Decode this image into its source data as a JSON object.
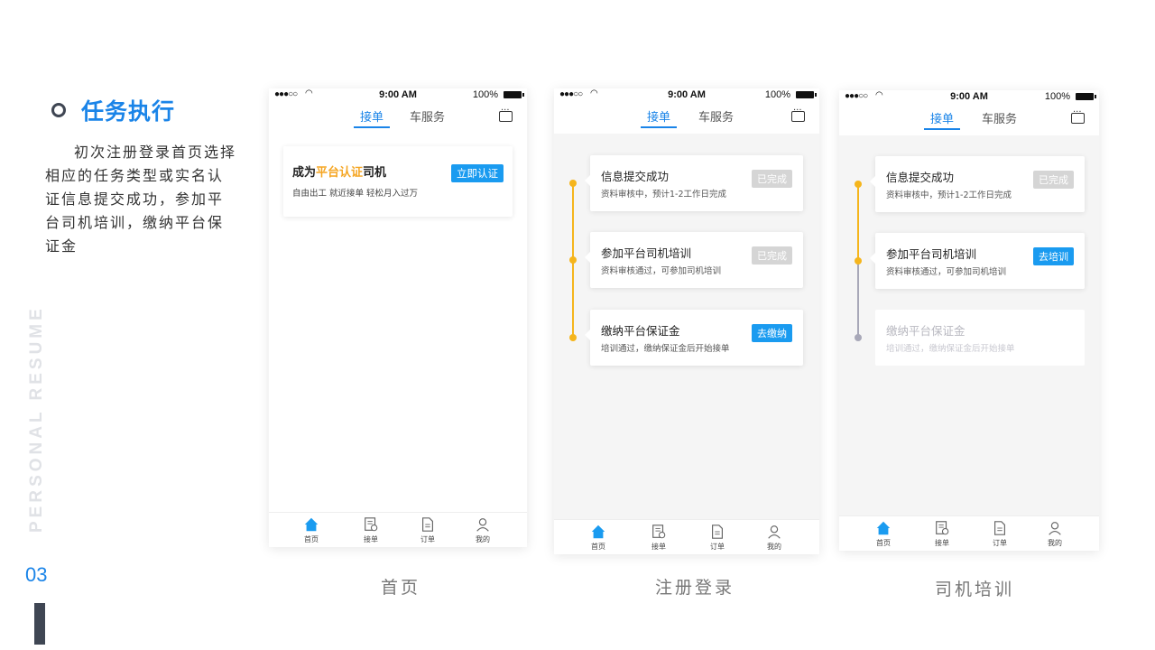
{
  "section": {
    "title": "任务执行",
    "description": "初次注册登录首页选择相应的任务类型或实名认证信息提交成功，参加平台司机培训，缴纳平台保证金",
    "vertical_text": "PERSONAL RESUME",
    "page_number": "03"
  },
  "status_bar": {
    "signal": "●●●○○",
    "wifi": "wifi-icon",
    "time": "9:00 AM",
    "battery": "100%"
  },
  "tabs": {
    "active": "接单",
    "other": "车服务"
  },
  "home": {
    "card": {
      "title_prefix": "成为",
      "title_highlight": "平台认证",
      "title_suffix": "司机",
      "subtitle": "自由出工 就近接单 轻松月入过万",
      "button": "立即认证"
    }
  },
  "tasks_register": [
    {
      "title": "信息提交成功",
      "subtitle": "资料审核中，预计1-2工作日完成",
      "button": "已完成",
      "state": "done"
    },
    {
      "title": "参加平台司机培训",
      "subtitle": "资料审核通过，可参加司机培训",
      "button": "已完成",
      "state": "done"
    },
    {
      "title": "缴纳平台保证金",
      "subtitle": "培训通过，缴纳保证金后开始接单",
      "button": "去缴纳",
      "state": "action"
    }
  ],
  "tasks_training": [
    {
      "title": "信息提交成功",
      "subtitle": "资料审核中，预计1-2工作日完成",
      "button": "已完成",
      "state": "done"
    },
    {
      "title": "参加平台司机培训",
      "subtitle": "资料审核通过，可参加司机培训",
      "button": "去培训",
      "state": "action"
    },
    {
      "title": "缴纳平台保证金",
      "subtitle": "培训通过，缴纳保证金后开始接单",
      "state": "disabled"
    }
  ],
  "bottom_nav": [
    {
      "label": "首页",
      "icon": "home-icon"
    },
    {
      "label": "接单",
      "icon": "clipboard-icon"
    },
    {
      "label": "订单",
      "icon": "document-icon"
    },
    {
      "label": "我的",
      "icon": "user-icon"
    }
  ],
  "captions": {
    "home": "首页",
    "register": "注册登录",
    "training": "司机培训"
  },
  "colors": {
    "accent": "#1a84e8",
    "button_blue": "#1a9bf0",
    "highlight": "#f5a623",
    "timeline": "#f5b51c",
    "inactive": "#a8a8b8"
  }
}
